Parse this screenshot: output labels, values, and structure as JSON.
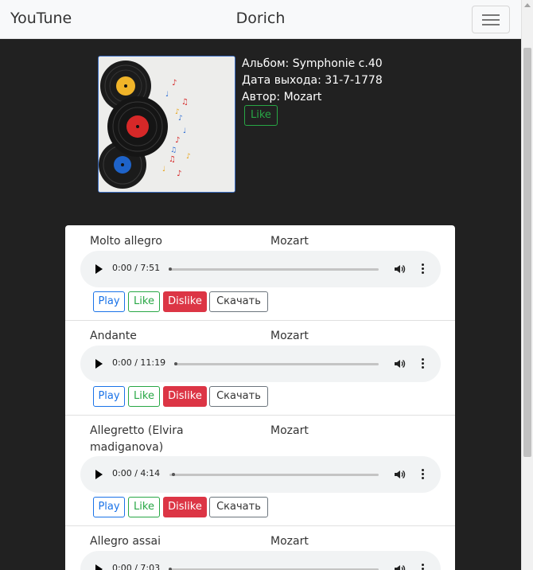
{
  "navbar": {
    "brand": "YouTune",
    "center": "Dorich",
    "menu_icon": "hamburger-icon"
  },
  "album": {
    "title": "Альбом: Symphonie c.40",
    "date": "Дата выхода: 31-7-1778",
    "author": "Автор: Mozart",
    "like_label": "Like",
    "cover_icon": "vinyl-records-image"
  },
  "tracks": [
    {
      "title": "Molto allegro",
      "artist": "Mozart",
      "time": "0:00 / 7:51",
      "progress": 0
    },
    {
      "title": "Andante",
      "artist": "Mozart",
      "time": "0:00 / 11:19",
      "progress": 0
    },
    {
      "title": "Allegretto (Elvira madiganova)",
      "artist": "Mozart",
      "time": "0:00 / 4:14",
      "progress": 0.01
    },
    {
      "title": "Allegro assai",
      "artist": "Mozart",
      "time": "0:00 / 7:03",
      "progress": 0
    }
  ],
  "buttons": {
    "play": "Play",
    "like": "Like",
    "dislike": "Dislike",
    "download": "Скачать"
  },
  "colors": {
    "background": "#212121",
    "like": "#28a745",
    "dislike": "#dc3545",
    "play": "#1a73e8"
  }
}
